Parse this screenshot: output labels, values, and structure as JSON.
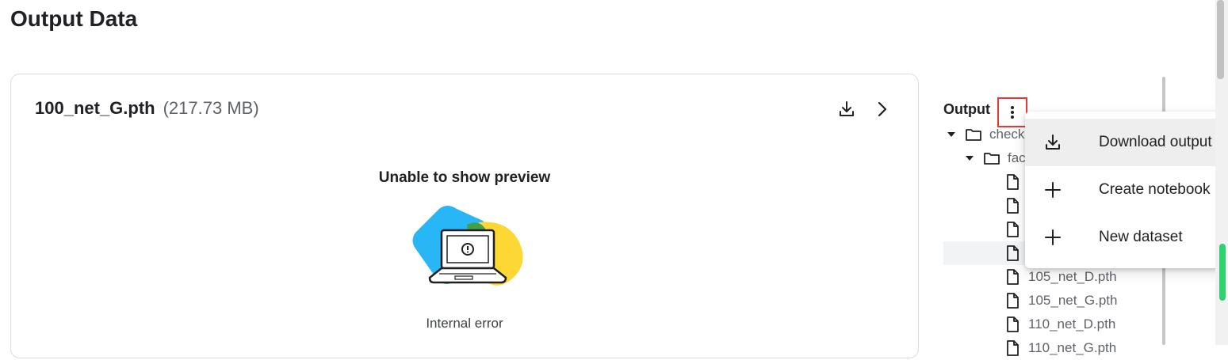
{
  "page": {
    "title": "Output Data"
  },
  "preview": {
    "file_name": "100_net_G.pth",
    "file_size": "(217.73 MB)",
    "message": "Unable to show preview",
    "error_text": "Internal error"
  },
  "output": {
    "title": "Output",
    "tree": [
      {
        "label": "checkpoints",
        "type": "folder",
        "level": 0,
        "expanded": true
      },
      {
        "label": "facades",
        "type": "folder",
        "level": 1,
        "expanded": true
      },
      {
        "label": "",
        "type": "file",
        "level": 2
      },
      {
        "label": "",
        "type": "file",
        "level": 2
      },
      {
        "label": "",
        "type": "file",
        "level": 2
      },
      {
        "label": "",
        "type": "file",
        "level": 2,
        "selected": true
      },
      {
        "label": "105_net_D.pth",
        "type": "file",
        "level": 2
      },
      {
        "label": "105_net_G.pth",
        "type": "file",
        "level": 2
      },
      {
        "label": "110_net_D.pth",
        "type": "file",
        "level": 2
      },
      {
        "label": "110_net_G.pth",
        "type": "file",
        "level": 2
      }
    ]
  },
  "menu": {
    "items": [
      {
        "label": "Download output",
        "icon": "download-icon"
      },
      {
        "label": "Create notebook",
        "icon": "plus-icon"
      },
      {
        "label": "New dataset",
        "icon": "plus-icon"
      }
    ]
  },
  "colors": {
    "accent_highlight": "#e53935",
    "scroll_indicator": "#2dd36f",
    "illustration_blue": "#29b6f6",
    "illustration_yellow": "#fdd835",
    "illustration_green": "#43a047"
  }
}
